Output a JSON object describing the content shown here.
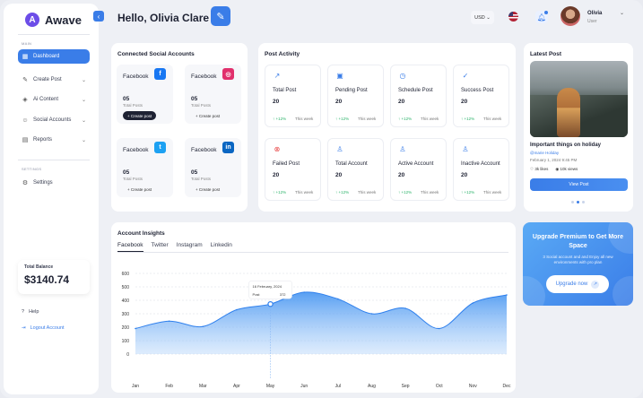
{
  "app": {
    "name": "Awave"
  },
  "sidebar": {
    "main_label": "MAIN",
    "settings_label": "SETTINGS",
    "items": [
      {
        "label": "Dashboard"
      },
      {
        "label": "Create Post"
      },
      {
        "label": "Ai Content"
      },
      {
        "label": "Social Accounts"
      },
      {
        "label": "Reports"
      }
    ],
    "settings": "Settings",
    "balance_label": "Total Balance",
    "balance_value": "$3140.74",
    "help": "Help",
    "logout": "Logout Account"
  },
  "header": {
    "greeting": "Hello, Olivia Clare",
    "currency": "USD",
    "user_name": "Olivia",
    "user_role": "User"
  },
  "social": {
    "title": "Connected Social Accounts",
    "cards": [
      {
        "name": "Facebook",
        "icon": "facebook-icon",
        "count": "05",
        "sub": "Total Posts",
        "button": "+ Create post",
        "color": "#1877f2"
      },
      {
        "name": "Facebook",
        "icon": "instagram-icon",
        "count": "05",
        "sub": "Total Posts",
        "button": "+ Create post",
        "color": "#e1306c"
      },
      {
        "name": "Facebook",
        "icon": "twitter-icon",
        "count": "05",
        "sub": "Total Posts",
        "button": "+ Create post",
        "color": "#1da1f2"
      },
      {
        "name": "Facebook",
        "icon": "linkedin-icon",
        "count": "05",
        "sub": "Total Posts",
        "button": "+ Create post",
        "color": "#0a66c2"
      }
    ]
  },
  "activity": {
    "title": "Post Activity",
    "items": [
      {
        "label": "Total Post",
        "value": "20",
        "change": "+12%",
        "period": "This week"
      },
      {
        "label": "Pending Post",
        "value": "20",
        "change": "+12%",
        "period": "This week"
      },
      {
        "label": "Schedule Post",
        "value": "20",
        "change": "+12%",
        "period": "This week"
      },
      {
        "label": "Success Post",
        "value": "20",
        "change": "+12%",
        "period": "This week"
      },
      {
        "label": "Failed Post",
        "value": "20",
        "change": "+12%",
        "period": "This week"
      },
      {
        "label": "Total Account",
        "value": "20",
        "change": "+12%",
        "period": "This week"
      },
      {
        "label": "Active Account",
        "value": "20",
        "change": "+12%",
        "period": "This week"
      },
      {
        "label": "Inactive Account",
        "value": "20",
        "change": "+12%",
        "period": "This week"
      }
    ]
  },
  "latest": {
    "title": "Latest Post",
    "post_title": "Important things on holiday",
    "author": "@marie Holiday",
    "date": "February 1, 2024   9:45 PM",
    "likes": "3k likes",
    "views": "10k views",
    "button": "View Post"
  },
  "upgrade": {
    "title": "Upgrade Premium to Get More Space",
    "desc": "3 Social account and and Enjoy all new environments with pro plan",
    "button": "Upgrade now"
  },
  "insights": {
    "title": "Account Insights",
    "tabs": [
      "Facebook",
      "Twitter",
      "Instagram",
      "Linkedin"
    ],
    "tooltip_date": "16 February, 2024",
    "tooltip_label": "Post",
    "tooltip_value": "372"
  },
  "chart_data": {
    "type": "area",
    "categories": [
      "Jan",
      "Feb",
      "Mar",
      "Apr",
      "May",
      "Jun",
      "Jul",
      "Aug",
      "Sep",
      "Oct",
      "Nov",
      "Dec"
    ],
    "series": [
      {
        "values": [
          190,
          245,
          205,
          330,
          372,
          460,
          410,
          300,
          340,
          190,
          380,
          440
        ]
      }
    ],
    "yticks": [
      0,
      100,
      200,
      300,
      400,
      500,
      600
    ],
    "ylim": [
      0,
      600
    ],
    "color": "#3a8ef0"
  }
}
